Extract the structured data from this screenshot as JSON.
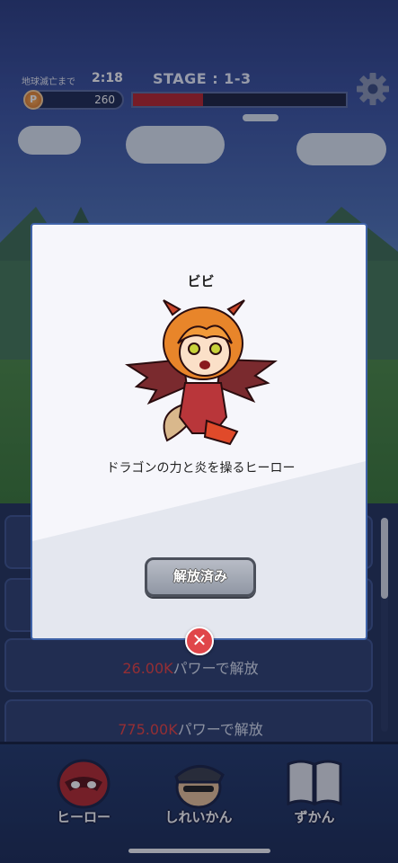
{
  "hud": {
    "timer_label": "地球滅亡まで",
    "timer_value": "2:18",
    "stage": "STAGE : 1-3",
    "coin_icon": "P",
    "coins": "260",
    "hp_fraction": 0.33
  },
  "list": {
    "rows": [
      {
        "cost": "26.00K",
        "suffix": "パワーで解放"
      },
      {
        "cost": "775.00K",
        "suffix": "パワーで解放"
      }
    ]
  },
  "nav": {
    "items": [
      {
        "label": "ヒーロー",
        "icon": "hero-mask-icon"
      },
      {
        "label": "しれいかん",
        "icon": "commander-icon"
      },
      {
        "label": "ずかん",
        "icon": "book-icon"
      }
    ]
  },
  "modal": {
    "hero_name": "ビビ",
    "hero_description": "ドラゴンの力と炎を操るヒーロー",
    "unlocked_label": "解放済み",
    "close_icon": "close-icon"
  },
  "colors": {
    "accent_red": "#e0464a",
    "cost_red": "#e84343",
    "nav_bg": "#233a6c"
  }
}
